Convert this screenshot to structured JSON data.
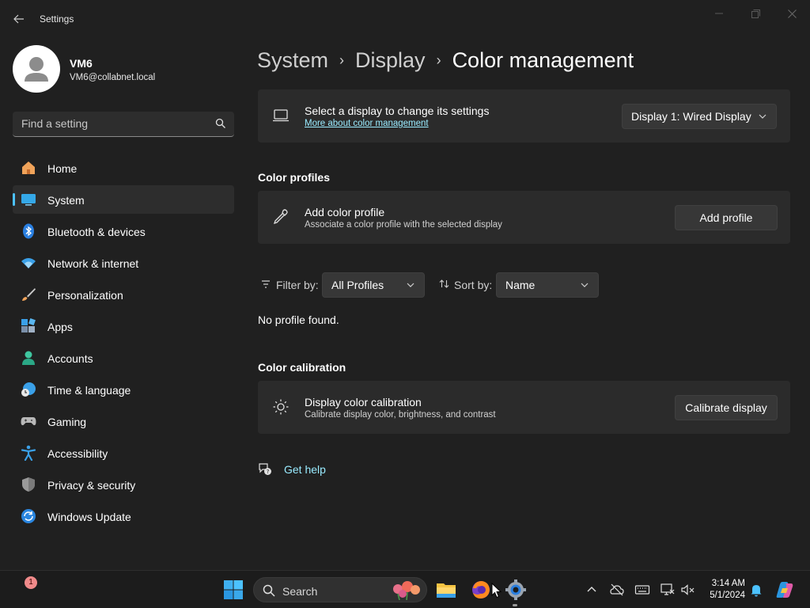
{
  "window": {
    "title": "Settings"
  },
  "user": {
    "name": "VM6",
    "email": "VM6@collabnet.local"
  },
  "search": {
    "placeholder": "Find a setting"
  },
  "sidebar": {
    "items": [
      {
        "label": "Home",
        "icon": "home-icon"
      },
      {
        "label": "System",
        "icon": "system-icon",
        "active": true
      },
      {
        "label": "Bluetooth & devices",
        "icon": "bluetooth-icon"
      },
      {
        "label": "Network & internet",
        "icon": "wifi-icon"
      },
      {
        "label": "Personalization",
        "icon": "brush-icon"
      },
      {
        "label": "Apps",
        "icon": "apps-icon"
      },
      {
        "label": "Accounts",
        "icon": "accounts-icon"
      },
      {
        "label": "Time & language",
        "icon": "clock-globe-icon"
      },
      {
        "label": "Gaming",
        "icon": "gamepad-icon"
      },
      {
        "label": "Accessibility",
        "icon": "accessibility-icon"
      },
      {
        "label": "Privacy & security",
        "icon": "shield-icon"
      },
      {
        "label": "Windows Update",
        "icon": "update-icon"
      }
    ]
  },
  "breadcrumb": {
    "part1": "System",
    "part2": "Display",
    "current": "Color management"
  },
  "display_select": {
    "title": "Select a display to change its settings",
    "link": "More about color management",
    "selected": "Display 1: Wired Display"
  },
  "color_profiles": {
    "section_title": "Color profiles",
    "add_title": "Add color profile",
    "add_sub": "Associate a color profile with the selected display",
    "add_button": "Add profile"
  },
  "filter": {
    "filter_label": "Filter by:",
    "filter_value": "All Profiles",
    "sort_label": "Sort by:",
    "sort_value": "Name",
    "empty_text": "No profile found."
  },
  "calibration": {
    "section_title": "Color calibration",
    "title": "Display color calibration",
    "sub": "Calibrate display color, brightness, and contrast",
    "button": "Calibrate display"
  },
  "help": {
    "label": "Get help"
  },
  "taskbar": {
    "badge": "1",
    "search_label": "Search",
    "time": "3:14 AM",
    "date": "5/1/2024"
  },
  "colors": {
    "accent": "#4cc2ff",
    "link": "#99ebff",
    "background": "#202020",
    "card": "#2b2b2b"
  }
}
